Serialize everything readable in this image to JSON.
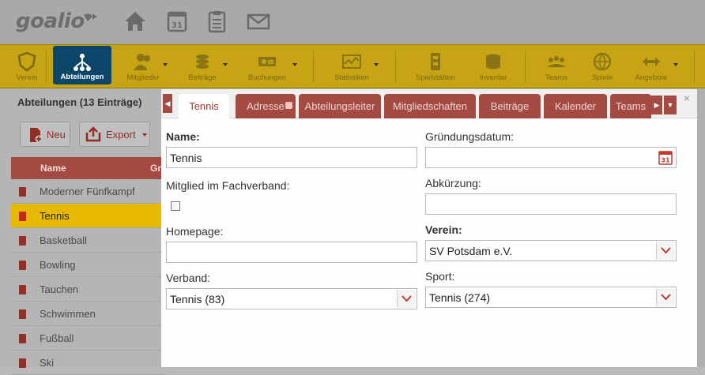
{
  "app": {
    "logo": "goalio"
  },
  "topnav": [
    {
      "name": "home-icon"
    },
    {
      "name": "calendar-icon",
      "day": "31"
    },
    {
      "name": "clipboard-icon"
    },
    {
      "name": "mail-icon"
    }
  ],
  "toolbar": {
    "verein": "Verein",
    "abteilungen": "Abteilungen",
    "mitglieder": "Mitglieder",
    "beitraege": "Beiträge",
    "buchungen": "Buchungen",
    "statistiken": "Statistiken",
    "spielstaetten": "Spielstätten",
    "inventar": "Inventar",
    "teams": "Teams",
    "spiele": "Spiele",
    "angebote": "Angebote"
  },
  "list": {
    "title": "Abteilungen (13 Einträge)",
    "new_label": "Neu",
    "export_label": "Export",
    "col_name": "Name",
    "col_second": "Gr",
    "rows": [
      "Moderner Fünfkampf",
      "Tennis",
      "Basketball",
      "Bowling",
      "Tauchen",
      "Schwimmen",
      "Fußball",
      "Ski"
    ],
    "selected_index": 1
  },
  "dialog": {
    "tabs": [
      "Tennis",
      "Adresse",
      "Abteilungsleiter",
      "Mitgliedschaften",
      "Beiträge",
      "Kalender",
      "Teams"
    ],
    "active_tab": 0,
    "close_label": "×",
    "form": {
      "name_label": "Name:",
      "name_value": "Tennis",
      "gruendung_label": "Gründungsdatum:",
      "gruendung_value": "",
      "calendar_day": "31",
      "fachverband_label": "Mitglied im Fachverband:",
      "fachverband_checked": false,
      "abkuerzung_label": "Abkürzung:",
      "abkuerzung_value": "",
      "homepage_label": "Homepage:",
      "homepage_value": "",
      "verein_label": "Verein:",
      "verein_value": "SV Potsdam e.V.",
      "verband_label": "Verband:",
      "verband_value": "Tennis (83)",
      "sport_label": "Sport:",
      "sport_value": "Tennis (274)"
    }
  },
  "colors": {
    "accent_red": "#a34a42",
    "toolbar_gold": "#c6a414",
    "active_blue": "#0c4769",
    "selection_yellow": "#e6b800"
  }
}
